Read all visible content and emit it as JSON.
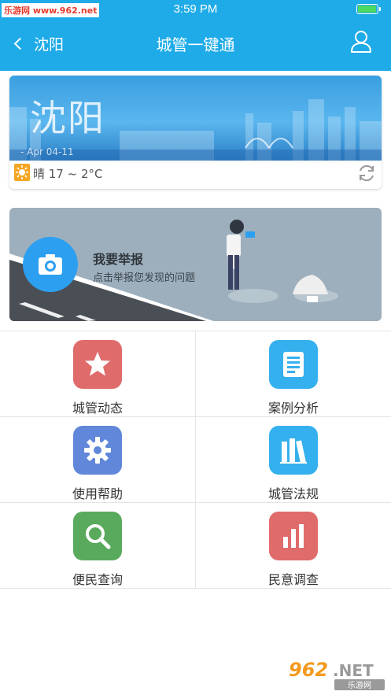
{
  "status_bar": {
    "watermark": "乐游网 www.962.net",
    "time": "3:59 PM",
    "battery_level": 1.0
  },
  "nav": {
    "back_label": "沈阳",
    "title": "城管一键通",
    "back_icon": "chevron-left-icon",
    "user_icon": "user-icon"
  },
  "weather": {
    "city": "沈阳",
    "date": "- Apr 04-11",
    "condition_icon": "sun-icon",
    "summary": "晴 17 ~ 2°C",
    "refresh_icon": "refresh-icon"
  },
  "report": {
    "title": "我要举报",
    "subtitle": "点击举报您发现的问题",
    "icon": "camera-icon"
  },
  "grid": [
    {
      "label": "城管动态",
      "icon": "star-icon",
      "color": "#e06b6b"
    },
    {
      "label": "案例分析",
      "icon": "document-icon",
      "color": "#35b0ee"
    },
    {
      "label": "使用帮助",
      "icon": "gear-icon",
      "color": "#6087d9"
    },
    {
      "label": "城管法规",
      "icon": "books-icon",
      "color": "#35b0ee"
    },
    {
      "label": "便民查询",
      "icon": "search-icon",
      "color": "#5aaa5e"
    },
    {
      "label": "民意调查",
      "icon": "bar-chart-icon",
      "color": "#e06b6b"
    }
  ],
  "colors": {
    "header": "#1eabe8",
    "accent": "#2d9ff0"
  },
  "footer_watermark": {
    "brand": "962.NET",
    "subtitle": "乐游网"
  }
}
